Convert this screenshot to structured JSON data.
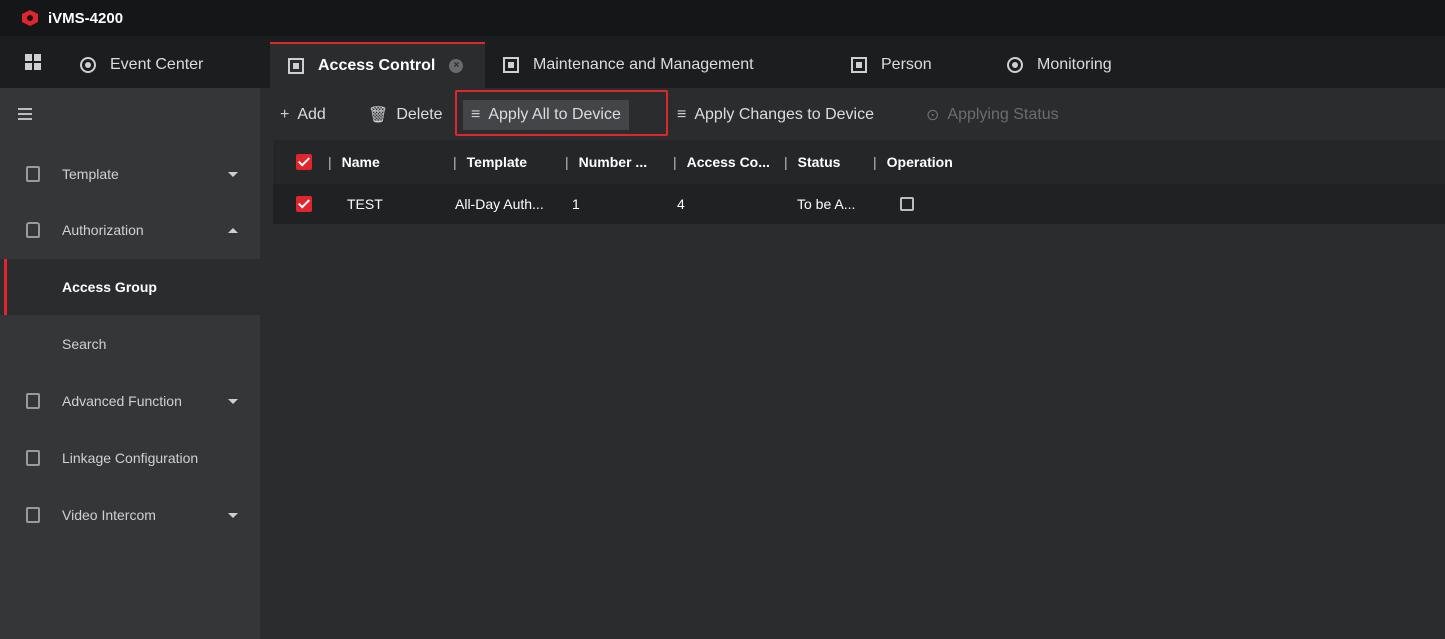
{
  "app": {
    "title": "iVMS-4200"
  },
  "tabs": [
    {
      "label": "Event Center",
      "icon": "alarm-icon"
    },
    {
      "label": "Access Control",
      "icon": "door-icon",
      "active": true
    },
    {
      "label": "Maintenance and Management",
      "icon": "settings-panel-icon"
    },
    {
      "label": "Person",
      "icon": "person-card-icon"
    },
    {
      "label": "Monitoring",
      "icon": "camera-icon"
    }
  ],
  "sidebar": {
    "items": [
      {
        "label": "Template",
        "icon": "template-icon",
        "expandable": true,
        "expanded": false
      },
      {
        "label": "Authorization",
        "icon": "lock-icon",
        "expandable": true,
        "expanded": true
      },
      {
        "label": "Access Group",
        "selected": true
      },
      {
        "label": "Search"
      },
      {
        "label": "Advanced Function",
        "icon": "advanced-function-icon",
        "expandable": true,
        "expanded": false
      },
      {
        "label": "Linkage Configuration",
        "icon": "linkage-icon"
      },
      {
        "label": "Video Intercom",
        "icon": "intercom-icon",
        "expandable": true,
        "expanded": false
      }
    ]
  },
  "toolbar": {
    "add": "Add",
    "delete": "Delete",
    "apply_all": "Apply All to Device",
    "apply_changes": "Apply Changes to Device",
    "applying_status": "Applying Status"
  },
  "table": {
    "headers": [
      "Name",
      "Template",
      "Number ...",
      "Access Co...",
      "Status",
      "Operation"
    ],
    "rows": [
      {
        "name": "TEST",
        "template": "All-Day Auth...",
        "number": "1",
        "access": "4",
        "status": "To be A...",
        "checked": true
      }
    ]
  },
  "colors": {
    "accent": "#e0262d",
    "background": "#2b2c2e",
    "sidebar": "#353638",
    "titlebar": "#151618"
  }
}
